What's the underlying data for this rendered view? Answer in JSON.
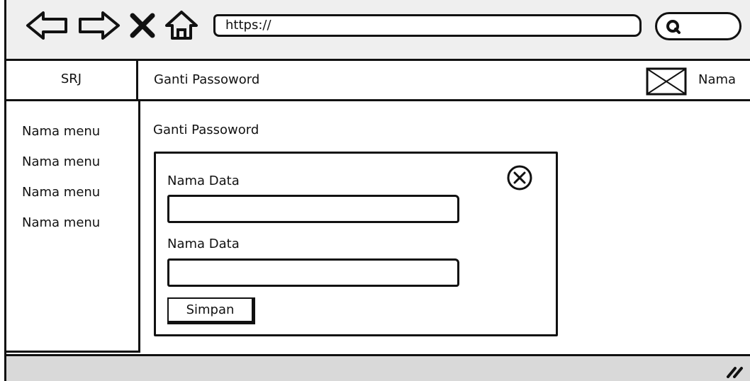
{
  "browser": {
    "url": "https://",
    "search_placeholder": ""
  },
  "app": {
    "brand": "SRJ",
    "header_title": "Ganti Passoword",
    "user_name": "Nama"
  },
  "sidebar": {
    "items": [
      {
        "label": "Nama menu"
      },
      {
        "label": "Nama menu"
      },
      {
        "label": "Nama menu"
      },
      {
        "label": "Nama menu"
      }
    ]
  },
  "content": {
    "title": "Ganti Passoword",
    "dialog": {
      "fields": [
        {
          "label": "Nama Data",
          "value": ""
        },
        {
          "label": "Nama Data",
          "value": ""
        }
      ],
      "submit_label": "Simpan"
    }
  },
  "icons": [
    "back-icon",
    "forward-icon",
    "close-x-icon",
    "home-icon",
    "search-icon",
    "image-placeholder-icon",
    "close-circle-icon",
    "resize-grip-icon"
  ]
}
